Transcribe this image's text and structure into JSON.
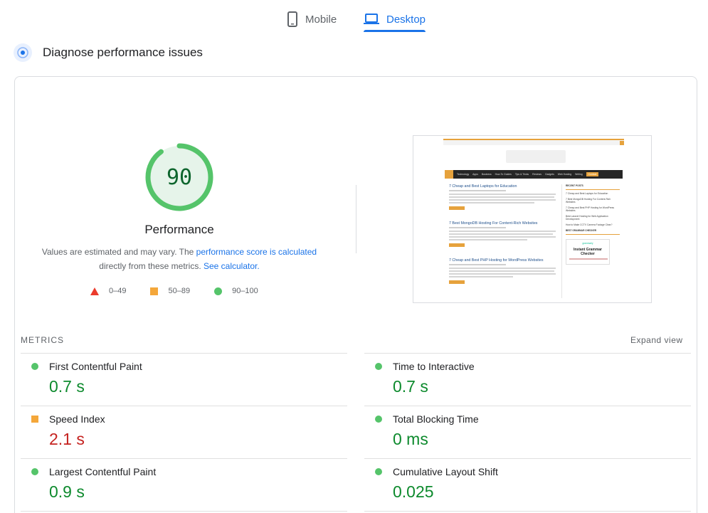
{
  "tabs": [
    {
      "label": "Mobile",
      "icon": "smartphone-icon",
      "selected": false
    },
    {
      "label": "Desktop",
      "icon": "laptop-icon",
      "selected": true
    }
  ],
  "section": {
    "title": "Diagnose performance issues",
    "icon": "diagnose-icon"
  },
  "performance": {
    "score": "90",
    "label": "Performance",
    "note_prefix": "Values are estimated and may vary. The ",
    "note_link": "performance score is calculated",
    "note_middle": " directly from these metrics. ",
    "note_link2": "See calculator.",
    "gauge_fraction": 0.9,
    "color_good": "#0d652d",
    "ring_color": "#55c46a"
  },
  "legend": [
    {
      "label": "0–49",
      "shape": "triangle",
      "color": "#eb3b2c"
    },
    {
      "label": "50–89",
      "shape": "square",
      "color": "#f4a73a"
    },
    {
      "label": "90–100",
      "shape": "circle",
      "color": "#55c46a"
    }
  ],
  "thumbnail": {
    "nav_items": [
      "Technology",
      "Apps",
      "Business",
      "How-To Guides",
      "Tips & Tricks",
      "Reviews",
      "Gadgets",
      "Web Hosting",
      "Writing",
      "Contact"
    ],
    "posts": [
      "7 Cheap and Best Laptops for Education",
      "7 Best MongoDB Hosting For Content-Rich Websites",
      "7 Cheap and Best PHP Hosting for WordPress Websites"
    ],
    "sidebar_heading": "RECENT POSTS",
    "sidebar_items": [
      "7 Cheap and Best Laptops for Education",
      "7 Best MongoDB Hosting For Content-Rich Websites",
      "7 Cheap and Best PHP Hosting for WordPress Websites",
      "Best Laravel Hosting for Web Application Development",
      "How to Make CCTV Camera Footage Clear?"
    ],
    "ad_heading": "BEST GRAMMAR CHECKER",
    "ad_brand": "grammarly",
    "ad_title": "Instant Grammar Checker"
  },
  "metrics": {
    "heading": "METRICS",
    "expand_label": "Expand view",
    "items": [
      {
        "name": "First Contentful Paint",
        "value": "0.7 s",
        "status": "good"
      },
      {
        "name": "Time to Interactive",
        "value": "0.7 s",
        "status": "good"
      },
      {
        "name": "Speed Index",
        "value": "2.1 s",
        "status": "average"
      },
      {
        "name": "Total Blocking Time",
        "value": "0 ms",
        "status": "good"
      },
      {
        "name": "Largest Contentful Paint",
        "value": "0.9 s",
        "status": "good"
      },
      {
        "name": "Cumulative Layout Shift",
        "value": "0.025",
        "status": "good"
      }
    ]
  }
}
